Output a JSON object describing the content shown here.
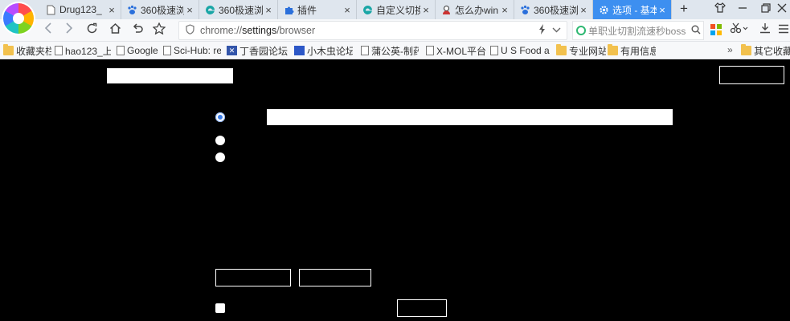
{
  "tabs": [
    {
      "title": "Drug123_",
      "icon": "page-icon",
      "active": false
    },
    {
      "title": "360极速浏",
      "icon": "paw-icon",
      "active": false
    },
    {
      "title": "360极速浏",
      "icon": "edge-icon",
      "active": false
    },
    {
      "title": "插件",
      "icon": "puzzle-icon",
      "active": false
    },
    {
      "title": "自定义切换",
      "icon": "edge-icon",
      "active": false
    },
    {
      "title": "怎么办win",
      "icon": "avatar-icon",
      "active": false
    },
    {
      "title": "360极速浏",
      "icon": "paw-icon",
      "active": false
    },
    {
      "title": "选项 - 基本",
      "icon": "gear-icon",
      "active": true
    }
  ],
  "address": {
    "scheme": "chrome://",
    "host": "settings",
    "path": "/browser"
  },
  "search": {
    "text": "单职业切割流速秒boss"
  },
  "bookmarks": [
    {
      "label": "收藏夹栏",
      "icon": "folder"
    },
    {
      "label": "hao123_上",
      "icon": "page"
    },
    {
      "label": "Google",
      "icon": "page"
    },
    {
      "label": "Sci-Hub: re",
      "icon": "page"
    },
    {
      "label": "丁香园论坛 ·",
      "icon": "flag"
    },
    {
      "label": "小木虫论坛-",
      "icon": "grid"
    },
    {
      "label": "蒲公英-制药",
      "icon": "page"
    },
    {
      "label": "X-MOL平台",
      "icon": "page"
    },
    {
      "label": "U S Food an",
      "icon": "page"
    },
    {
      "label": "专业网站",
      "icon": "folder"
    },
    {
      "label": "有用信息",
      "icon": "folder"
    }
  ],
  "bookmarks_overflow": {
    "more_glyph": "»",
    "other_label": "其它收藏"
  },
  "settings": {
    "radio_selected_index": 0,
    "checkbox_checked": false
  }
}
